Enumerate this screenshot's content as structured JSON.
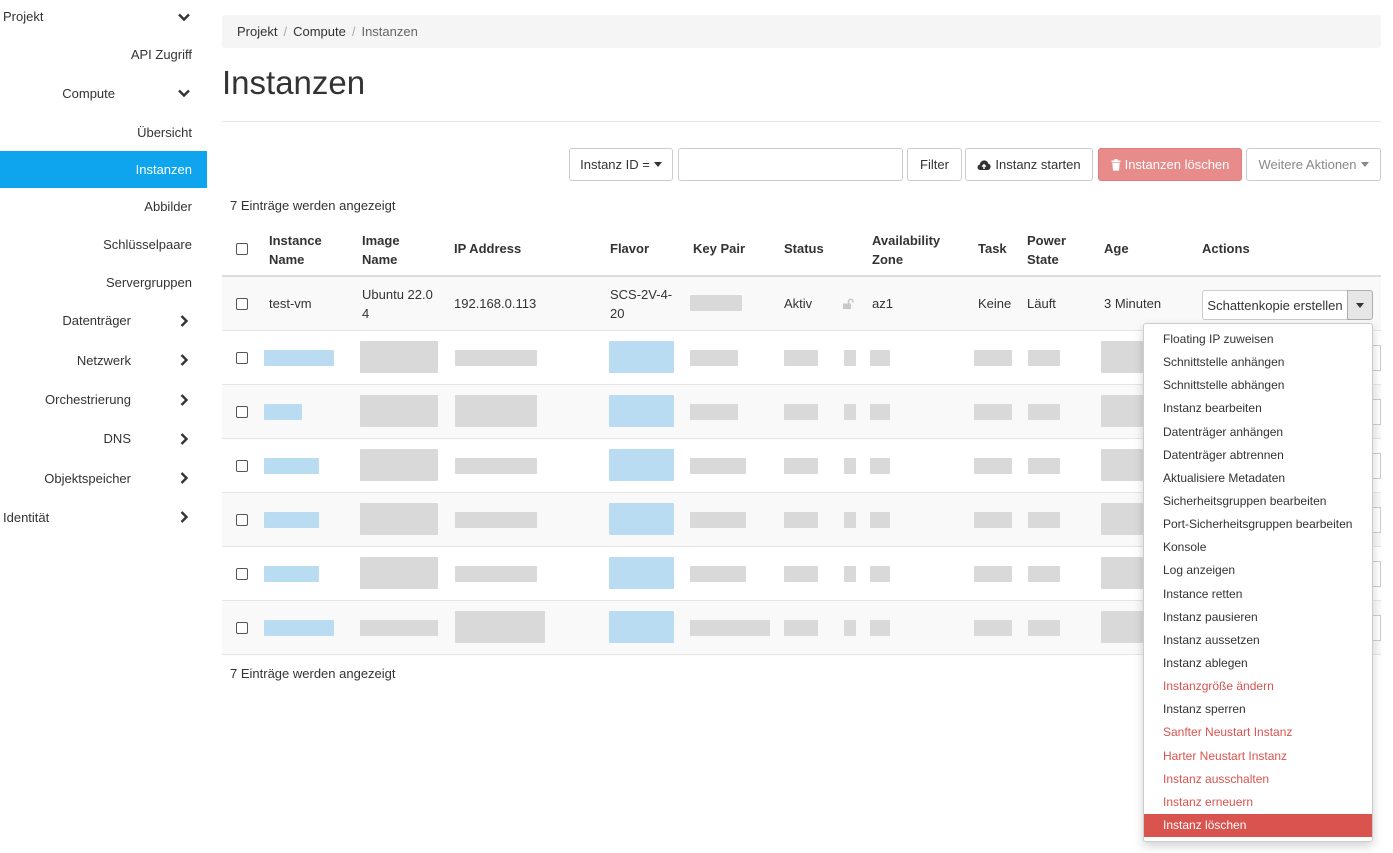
{
  "sidebar": {
    "items": [
      {
        "label": "Projekt"
      },
      {
        "label": "API Zugriff"
      },
      {
        "label": "Compute"
      },
      {
        "label": "Übersicht"
      },
      {
        "label": "Instanzen"
      },
      {
        "label": "Abbilder"
      },
      {
        "label": "Schlüsselpaare"
      },
      {
        "label": "Servergruppen"
      },
      {
        "label": "Datenträger"
      },
      {
        "label": "Netzwerk"
      },
      {
        "label": "Orchestrierung"
      },
      {
        "label": "DNS"
      },
      {
        "label": "Objektspeicher"
      },
      {
        "label": "Identität"
      }
    ]
  },
  "breadcrumb": {
    "items": [
      "Projekt",
      "Compute",
      "Instanzen"
    ],
    "separator": "/"
  },
  "page": {
    "title": "Instanzen"
  },
  "toolbar": {
    "filter_select": "Instanz ID =",
    "filter_value": "",
    "filter_button": "Filter",
    "launch_button": "Instanz starten",
    "delete_button": "Instanzen löschen",
    "more_actions": "Weitere Aktionen"
  },
  "table": {
    "entries_text": "7 Einträge werden angezeigt",
    "headers": [
      "Instance Name",
      "Image Name",
      "IP Address",
      "Flavor",
      "Key Pair",
      "Status",
      "Availability Zone",
      "Task",
      "Power State",
      "Age",
      "Actions"
    ],
    "header_lines": {
      "instance_name": [
        "Instance",
        "Name"
      ],
      "image_name": [
        "Image",
        "Name"
      ],
      "availability_zone": [
        "Availability",
        "Zone"
      ],
      "power_state": [
        "Power",
        "State"
      ]
    },
    "rows": [
      {
        "name": "test-vm",
        "image": [
          "Ubuntu 22.0",
          "4"
        ],
        "ip": "192.168.0.113",
        "flavor": [
          "SCS-2V-4-",
          "20"
        ],
        "status": "Aktiv",
        "az": "az1",
        "task": "Keine",
        "power": "Läuft",
        "age": "3 Minuten",
        "action": "Schattenkopie erstellen"
      }
    ],
    "blurred_rows": 6
  },
  "dropdown": {
    "items": [
      {
        "label": "Floating IP zuweisen",
        "style": "normal"
      },
      {
        "label": "Schnittstelle anhängen",
        "style": "normal"
      },
      {
        "label": "Schnittstelle abhängen",
        "style": "normal"
      },
      {
        "label": "Instanz bearbeiten",
        "style": "normal"
      },
      {
        "label": "Datenträger anhängen",
        "style": "normal"
      },
      {
        "label": "Datenträger abtrennen",
        "style": "normal"
      },
      {
        "label": "Aktualisiere Metadaten",
        "style": "normal"
      },
      {
        "label": "Sicherheitsgruppen bearbeiten",
        "style": "normal"
      },
      {
        "label": "Port-Sicherheitsgruppen bearbeiten",
        "style": "normal"
      },
      {
        "label": "Konsole",
        "style": "normal"
      },
      {
        "label": "Log anzeigen",
        "style": "normal"
      },
      {
        "label": "Instance retten",
        "style": "normal"
      },
      {
        "label": "Instanz pausieren",
        "style": "normal"
      },
      {
        "label": "Instanz aussetzen",
        "style": "normal"
      },
      {
        "label": "Instanz ablegen",
        "style": "normal"
      },
      {
        "label": "Instanzgröße ändern",
        "style": "danger"
      },
      {
        "label": "Instanz sperren",
        "style": "normal"
      },
      {
        "label": "Sanfter Neustart Instanz",
        "style": "danger"
      },
      {
        "label": "Harter Neustart Instanz",
        "style": "danger"
      },
      {
        "label": "Instanz ausschalten",
        "style": "danger"
      },
      {
        "label": "Instanz erneuern",
        "style": "danger"
      },
      {
        "label": "Instanz löschen",
        "style": "active-danger"
      }
    ]
  },
  "colors": {
    "accent": "#0ea5ee",
    "link": "#0099e0",
    "danger": "#d9534f",
    "delete_button_bg": "#e88b8b"
  }
}
